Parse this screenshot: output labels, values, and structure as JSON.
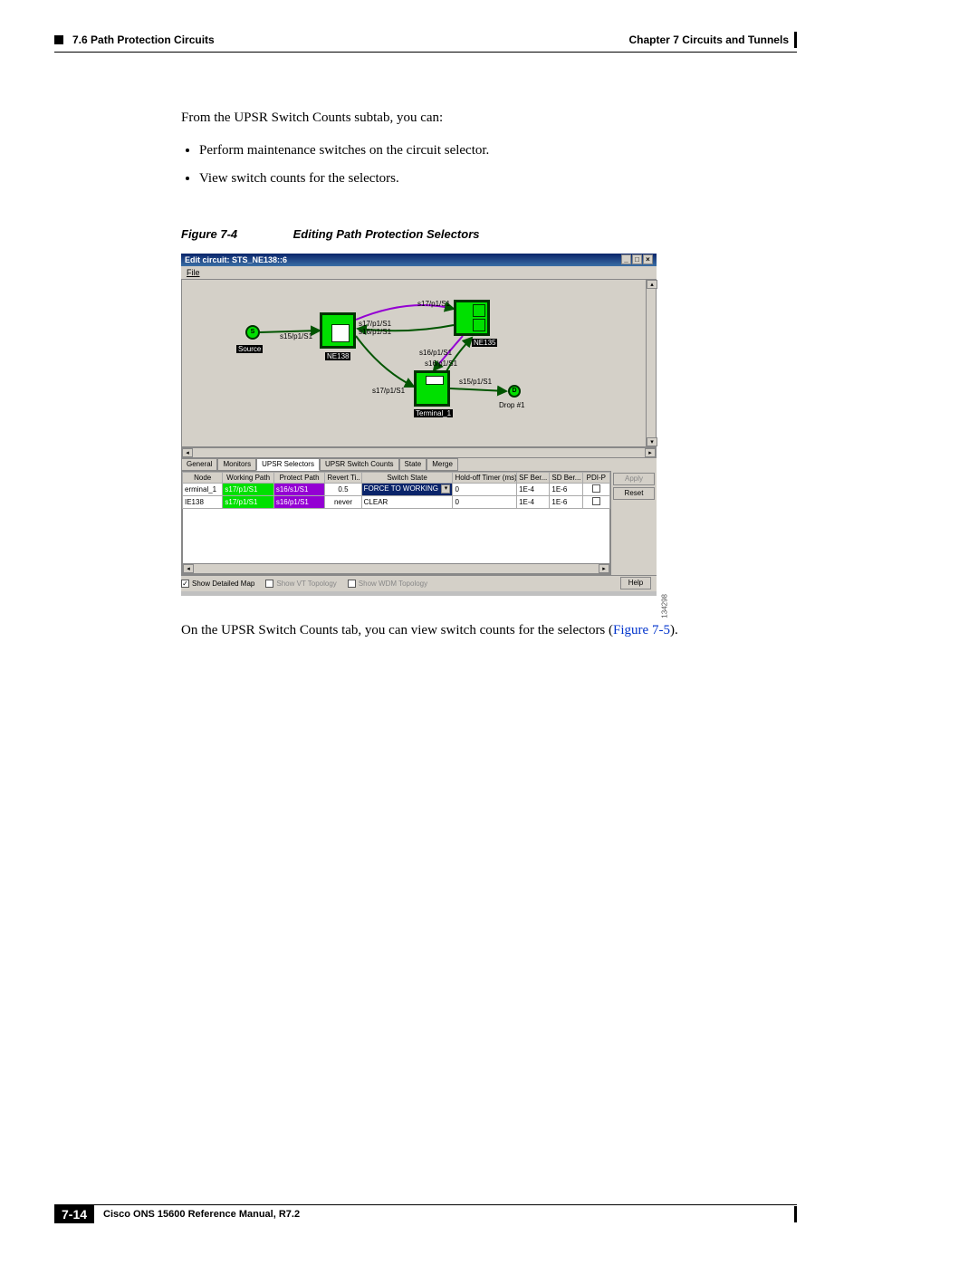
{
  "header": {
    "section": "7.6  Path Protection Circuits",
    "chapter": "Chapter 7 Circuits and Tunnels"
  },
  "body": {
    "intro": "From the UPSR Switch Counts subtab, you can:",
    "bullets": [
      "Perform maintenance switches on the circuit selector.",
      "View switch counts for the selectors."
    ]
  },
  "figure": {
    "number": "Figure 7-4",
    "title": "Editing Path Protection Selectors",
    "window_title": "Edit circuit: STS_NE138::6",
    "file_menu": "File",
    "nodes": {
      "source": {
        "letter": "S",
        "label": "Source"
      },
      "ne138": {
        "label": "NE138"
      },
      "ne135": {
        "label": "NE135"
      },
      "terminal": {
        "label": "Terminal_1"
      },
      "drop": {
        "letter": "D",
        "label": "Drop #1"
      }
    },
    "links": {
      "l_s15_a": "s15/p1/S1",
      "l_s17_a": "s17/p1/S1",
      "l_s17_b": "s17/p1/S1",
      "l_s16_a": "s16/p1/S1",
      "l_s16_b": "s16/p1/S1",
      "l_s16_c": "s16/p1/S1",
      "l_s15_b": "s15/p1/S1",
      "l_s17_c": "s17/p1/S1"
    },
    "tabs": [
      "General",
      "Monitors",
      "UPSR Selectors",
      "UPSR Switch Counts",
      "State",
      "Merge"
    ],
    "active_tab_index": 2,
    "columns": [
      "Node",
      "Working Path",
      "Protect Path",
      "Revert Ti..",
      "Switch State",
      "Hold-off Timer (ms)",
      "SF Ber...",
      "SD Ber...",
      "PDI-P"
    ],
    "rows": [
      {
        "node": "erminal_1",
        "wp": "s17/p1/S1",
        "pp": "s16/s1/S1",
        "rt": "0.5",
        "ss": "FORCE TO WORKING",
        "ho": "0",
        "sf": "1E-4",
        "sd": "1E-6",
        "pdip": false
      },
      {
        "node": "IE138",
        "wp": "s17/p1/S1",
        "pp": "s16/p1/S1",
        "rt": "never",
        "ss": "CLEAR",
        "ho": "0",
        "sf": "1E-4",
        "sd": "1E-6",
        "pdip": false
      }
    ],
    "side_buttons": {
      "apply": "Apply",
      "reset": "Reset"
    },
    "footer": {
      "detailed": "Show Detailed Map",
      "vt": "Show VT Topology",
      "wdm": "Show WDM Topology",
      "help": "Help"
    },
    "imgid": "134298"
  },
  "after_figure": {
    "text": "On the UPSR Switch Counts tab, you can view switch counts for the selectors (",
    "link": "Figure 7-5",
    "tail": ")."
  },
  "page_footer": {
    "manual": "Cisco ONS 15600 Reference Manual, R7.2",
    "pagenum": "7-14"
  }
}
